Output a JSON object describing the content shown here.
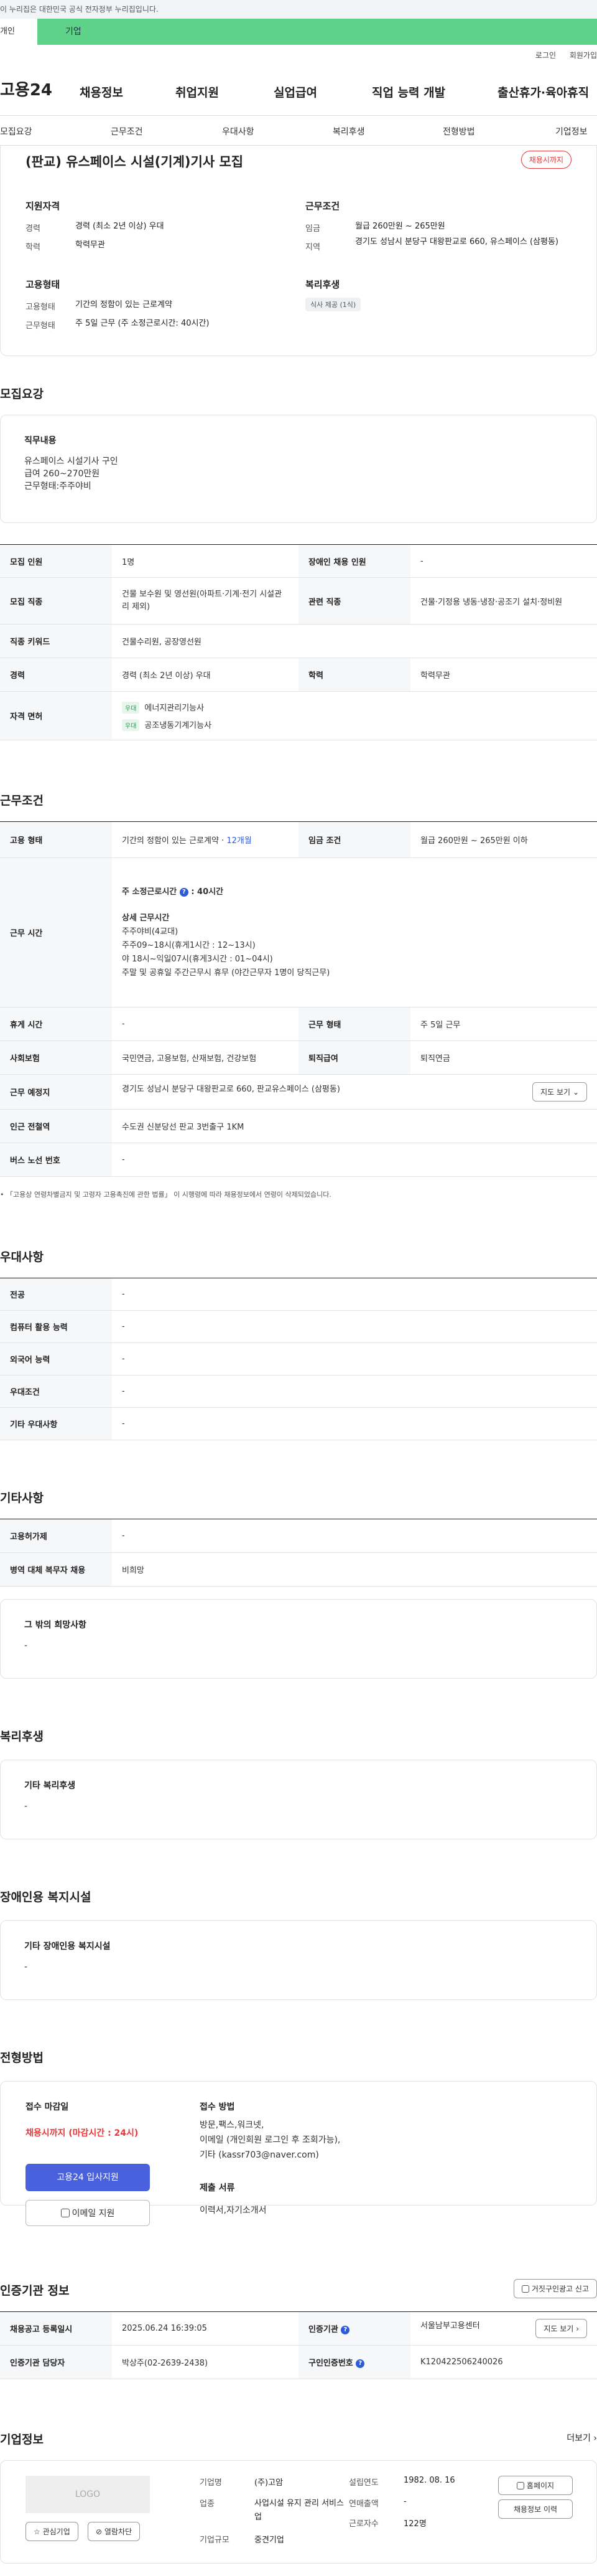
{
  "gov_notice": "이 누리집은 대한민국 공식 전자정부 누리집입니다.",
  "top_tabs": {
    "individual": "개인",
    "business": "기업"
  },
  "util": {
    "login": "로그인",
    "join": "회원가입"
  },
  "logo": "고용24",
  "gnb": [
    "채용정보",
    "취업지원",
    "실업급여",
    "직업 능력 개발",
    "출산휴가·육아휴직"
  ],
  "subnav": [
    "모집요강",
    "근무조건",
    "우대사항",
    "복리후생",
    "전형방법",
    "기업정보"
  ],
  "summary": {
    "title": "(판교) 유스페이스 시설(기계)기사 모집",
    "deadline_badge": "채용시까지",
    "qual_heading": "지원자격",
    "cond_heading": "근무조건",
    "emp_heading": "고용형태",
    "welfare_heading": "복리후생",
    "career_k": "경력",
    "career_v": "경력 (최소 2년 이상) 우대",
    "edu_k": "학력",
    "edu_v": "학력무관",
    "wage_k": "임금",
    "wage_v": "월급 260만원 ~ 265만원",
    "region_k": "지역",
    "region_v": "경기도 성남시 분당구 대왕판교로 660, 유스페이스 (삼평동)",
    "emptype_k": "고용형태",
    "emptype_v": "기간의 정함이 있는 근로계약",
    "worktype_k": "근무형태",
    "worktype_v": "주 5일 근무 (주 소정근로시간: 40시간)",
    "welfare_chip": "식사 제공 (1식)"
  },
  "recruit": {
    "heading": "모집요강",
    "duty_heading": "직무내용",
    "duty_lines": [
      "유스페이스 시설기사 구인",
      "급여 260~270만원",
      "근무형태:주주야비"
    ],
    "rows": [
      {
        "k1": "모집 인원",
        "v1": "1명",
        "k2": "장애인 채용 인원",
        "v2": "-"
      },
      {
        "k1": "모집 직종",
        "v1": "건물 보수원 및 영선원(아파트·기계·전기 시설관리 제외)",
        "k2": "관련 직종",
        "v2": "건물·기정용 냉동·냉장·공조기 설치·정비원"
      },
      {
        "k1": "직종 키워드",
        "v1": "건물수리원, 공장영선원"
      },
      {
        "k1": "경력",
        "v1": "경력 (최소 2년 이상) 우대",
        "k2": "학력",
        "v2": "학력무관"
      },
      {
        "k1": "자격 면허",
        "licenses": [
          {
            "tag": "우대",
            "name": "에너지관리기능사"
          },
          {
            "tag": "우대",
            "name": "공조냉동기계기능사"
          }
        ]
      }
    ]
  },
  "conditions": {
    "heading": "근무조건",
    "emptype_k": "고용 형태",
    "emptype_v": "기간의 정함이 있는 근로계약 · ",
    "emptype_months": "12개월",
    "wage_k": "임금 조건",
    "wage_v": "월급 260만원 ~ 265만원 이하",
    "hours_k": "근무 시간",
    "hours_main": "주 소정근로시간",
    "hours_main_v": ": 40시간",
    "hours_detail_title": "상세 근무시간",
    "hours_detail": [
      "주주야비(4교대)",
      "주주09~18시(휴게1시간 : 12~13시)",
      "야 18시~익일07시(휴게3시간 : 01~04시)",
      "주말 및 공휴일 주간근무시 휴무 (야간근무자 1명이 당직근무)"
    ],
    "holiday_k": "휴게 시간",
    "holiday_v": "-",
    "worktype_k": "근무 형태",
    "worktype_v": "주 5일 근무",
    "insurance_k": "사회보험",
    "insurance_v": "국민연금, 고용보험, 산재보험, 건강보험",
    "retire_k": "퇴직급여",
    "retire_v": "퇴직연금",
    "place_k": "근무 예정지",
    "place_v": "경기도 성남시 분당구 대왕판교로 660, 판교유스페이스 (삼평동)",
    "map_btn": "지도 보기",
    "station_k": "인근 전철역",
    "station_v": "수도권 신분당선 판교 3번출구 1KM",
    "bus_k": "버스 노선 번호",
    "bus_v": "-",
    "note": "「고용상 연령차별금지 및 고령자 고용촉진에 관한 법률」 이 시행령에 따라 채용정보에서 연령이 삭제되었습니다."
  },
  "preference": {
    "heading": "우대사항",
    "rows": [
      {
        "k": "전공",
        "v": "-"
      },
      {
        "k": "컴퓨터 활용 능력",
        "v": "-"
      },
      {
        "k": "외국어 능력",
        "v": "-"
      },
      {
        "k": "우대조건",
        "v": "-"
      },
      {
        "k": "기타 우대사항",
        "v": "-"
      }
    ]
  },
  "etc": {
    "heading": "기타사항",
    "rows": [
      {
        "k": "고용허가제",
        "v": "-"
      },
      {
        "k": "병역 대체 복무자 채용",
        "v": "비희망"
      }
    ],
    "hope_heading": "그 밖의 희망사항",
    "hope_v": "-"
  },
  "welfare": {
    "heading": "복리후생",
    "box_heading": "기타 복리후생",
    "box_v": "-"
  },
  "disability": {
    "heading": "장애인용 복지시설",
    "box_heading": "기타 장애인용 복지시설",
    "box_v": "-"
  },
  "selection": {
    "heading": "전형방법",
    "deadline_heading": "접수 마감일",
    "deadline_v": "채용시까지 (마감시간 : 24시)",
    "apply_btn": "고용24 입사지원",
    "email_btn": "이메일 지원",
    "method_heading": "접수 방법",
    "method_lines": [
      "방문,팩스,워크넷,",
      "이메일 (개인회원 로그인 후 조회가능),",
      "기타 (kassr703@naver.com)"
    ],
    "docs_heading": "제출 서류",
    "docs_v": "이력서,자기소개서"
  },
  "cert": {
    "heading": "인증기관 정보",
    "report_btn": "거짓구인광고 신고",
    "reg_k": "채용공고 등록일시",
    "reg_v": "2025.06.24 16:39:05",
    "org_k": "인증기관",
    "org_v": "서울남부고용센터",
    "map_btn": "지도 보기",
    "person_k": "인증기관 담당자",
    "person_v": "박상주(02-2639-2438)",
    "no_k": "구인인증번호",
    "no_v": "K120422506240026"
  },
  "company": {
    "heading": "기업정보",
    "more": "더보기",
    "logo_text": "LOGO",
    "fav_btn": "관심기업",
    "block_btn": "열람차단",
    "name_k": "기업명",
    "name_v": "(주)고암",
    "industry_k": "업종",
    "industry_v": "사업시설 유지 관리 서비스업",
    "scale_k": "기업규모",
    "scale_v": "중견기업",
    "founded_k": "설립연도",
    "founded_v": "1982. 08. 16",
    "sales_k": "연매출액",
    "sales_v": "-",
    "emp_k": "근로자수",
    "emp_v": "122명",
    "home_btn": "홈페이지",
    "jobs_btn": "채용정보 이력"
  }
}
